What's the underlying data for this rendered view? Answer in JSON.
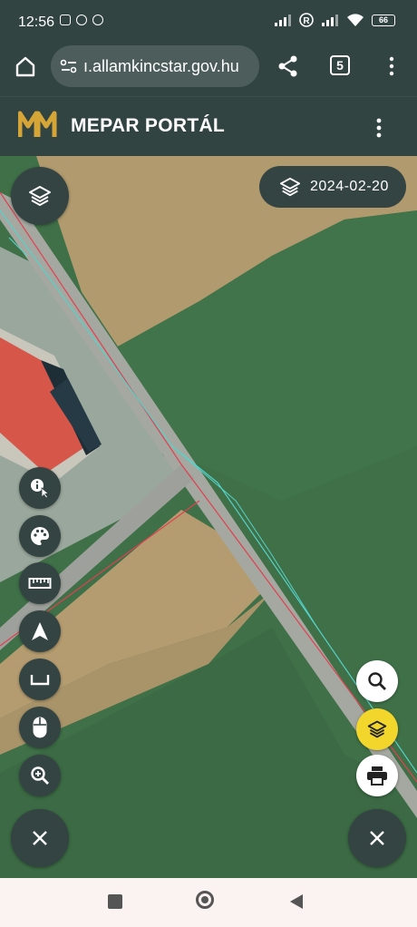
{
  "status_bar": {
    "time": "12:56",
    "battery": "66",
    "icons": [
      "instagram-icon",
      "viber-icon",
      "app-icon",
      "signal-icon",
      "r-icon",
      "signal-icon",
      "wifi-icon",
      "battery-icon"
    ]
  },
  "browser": {
    "url": "ı.allamkincstar.gov.hu",
    "tab_count": "5",
    "icons": [
      "home-icon",
      "site-settings-icon",
      "share-icon",
      "tabs-icon",
      "more-vert-icon"
    ]
  },
  "app": {
    "title": "MEPAR PORTÁL",
    "logo": "mepar-logo",
    "colors": {
      "bar": "#324442",
      "accent": "#f2d62c",
      "logo": "#d6a537"
    }
  },
  "map": {
    "imagery_date": "2024-02-20",
    "tools": [
      "info-icon",
      "palette-icon",
      "ruler-icon",
      "navigation-icon",
      "area-measure-icon",
      "mouse-icon",
      "zoom-in-icon"
    ],
    "right_tools": [
      "search-icon",
      "layers-icon",
      "print-icon"
    ]
  }
}
